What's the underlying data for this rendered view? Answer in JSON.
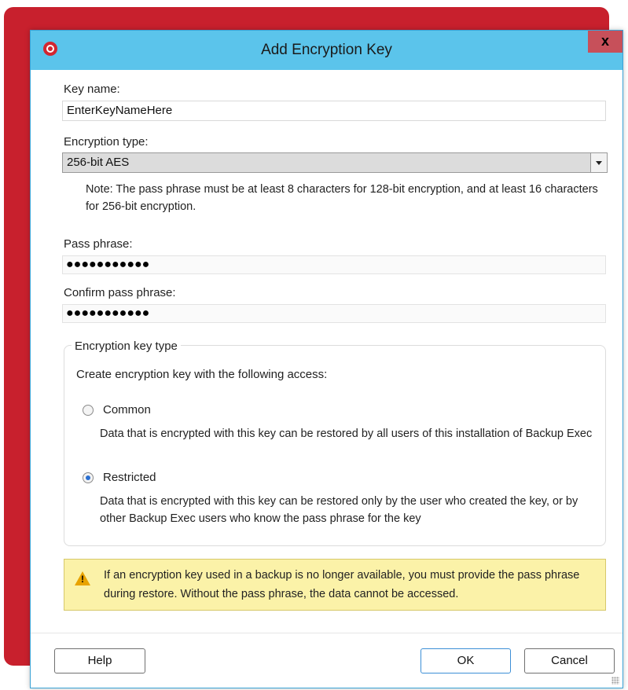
{
  "window": {
    "title": "Add Encryption Key",
    "close_label": "x"
  },
  "form": {
    "key_name_label": "Key name:",
    "key_name_value": "EnterKeyNameHere",
    "encryption_type_label": "Encryption type:",
    "encryption_type_value": "256-bit AES",
    "note": "Note: The pass phrase must be at least 8 characters for 128-bit encryption, and at least 16 characters for 256-bit encryption.",
    "pass_phrase_label": "Pass phrase:",
    "pass_phrase_value": "●●●●●●●●●●●",
    "confirm_label": "Confirm pass phrase:",
    "confirm_value": "●●●●●●●●●●●"
  },
  "key_type": {
    "legend": "Encryption key type",
    "instruction": "Create encryption key with the following access:",
    "options": [
      {
        "label": "Common",
        "description": "Data that is encrypted with this key can be restored by all users of this installation of Backup Exec",
        "checked": false
      },
      {
        "label": "Restricted",
        "description": "Data that is encrypted with this key can be restored only by the user who created the key, or by other Backup Exec users who know the pass phrase for the key",
        "checked": true
      }
    ]
  },
  "warning": {
    "icon": "warning-icon",
    "text": "If an encryption key used in a backup is no longer available, you must provide the pass phrase during restore.  Without the pass phrase, the data cannot be accessed."
  },
  "buttons": {
    "help": "Help",
    "ok": "OK",
    "cancel": "Cancel"
  },
  "colors": {
    "titlebar": "#5bc4eb",
    "close": "#c7505a",
    "background_card": "#c8202d",
    "warning_bg": "#fbf2a8",
    "radio_selected": "#2a6fd1"
  }
}
